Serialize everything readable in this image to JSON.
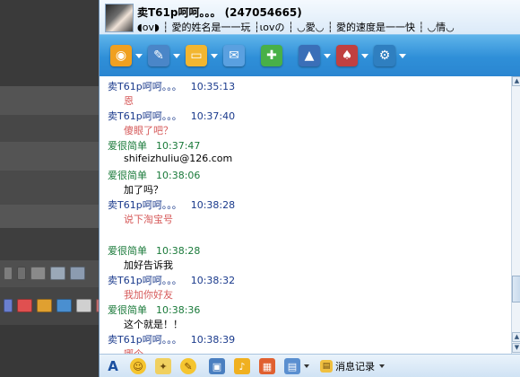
{
  "window": {
    "title": "卖T61p呵呵。。。 (247054665)",
    "signature": "◖ov◗ ┆ 愛的姓名是一一玩  ┆ιovの  ┆ ◡愛◡  ┆ 愛的速度是一一快  ┆ ◡情◡"
  },
  "toolbar": {
    "buttons": [
      {
        "name": "video-chat",
        "icon": "webcam-icon",
        "color": "#f0a020"
      },
      {
        "name": "voice-chat",
        "icon": "microphone-icon",
        "color": "#4a86c8"
      },
      {
        "name": "send-file",
        "icon": "folder-icon",
        "color": "#f2b630"
      },
      {
        "name": "send-sms",
        "icon": "envelope-icon",
        "color": "#5aa0e0"
      },
      {
        "name": "add-item",
        "icon": "add-doc-icon",
        "color": "#48b048"
      },
      {
        "name": "remote",
        "icon": "hat-icon",
        "color": "#3a6fb8"
      },
      {
        "name": "games",
        "icon": "cards-icon",
        "color": "#c04040"
      },
      {
        "name": "apps",
        "icon": "apps-icon",
        "color": "#2f7fc0"
      }
    ]
  },
  "messages": [
    {
      "sender": "卖T61p呵呵。。。",
      "time": "10:35:13",
      "text": "恩",
      "side": "mine",
      "text_color": "red"
    },
    {
      "sender": "卖T61p呵呵。。。",
      "time": "10:37:40",
      "text": "傻眼了吧？",
      "side": "mine",
      "text_color": "red"
    },
    {
      "sender": "爱很简单",
      "time": "10:37:47",
      "text": "shifeizhuliu@126.com",
      "side": "theirs",
      "text_color": "black"
    },
    {
      "sender": "爱很简单",
      "time": "10:38:06",
      "text": "加了吗？",
      "side": "theirs",
      "text_color": "black"
    },
    {
      "sender": "卖T61p呵呵。。。",
      "time": "10:38:28",
      "text": "说下淘宝号",
      "side": "mine",
      "text_color": "red"
    },
    {
      "sender": "爱很简单",
      "time": "10:38:28",
      "text": "加好告诉我",
      "side": "theirs",
      "text_color": "black"
    },
    {
      "sender": "卖T61p呵呵。。。",
      "time": "10:38:32",
      "text": "我加你好友",
      "side": "mine",
      "text_color": "red"
    },
    {
      "sender": "爱很简单",
      "time": "10:38:36",
      "text": "这个就是！！",
      "side": "theirs",
      "text_color": "black"
    },
    {
      "sender": "卖T61p呵呵。。。",
      "time": "10:38:39",
      "text": "哪个",
      "side": "mine",
      "text_color": "red"
    }
  ],
  "bottombar": {
    "history_label": "消息记录",
    "icons": [
      "font-icon",
      "emoticon-icon",
      "magic-face-icon",
      "scribble-icon",
      "screenshot-icon",
      "music-icon",
      "gift-icon",
      "doc-icon"
    ]
  }
}
